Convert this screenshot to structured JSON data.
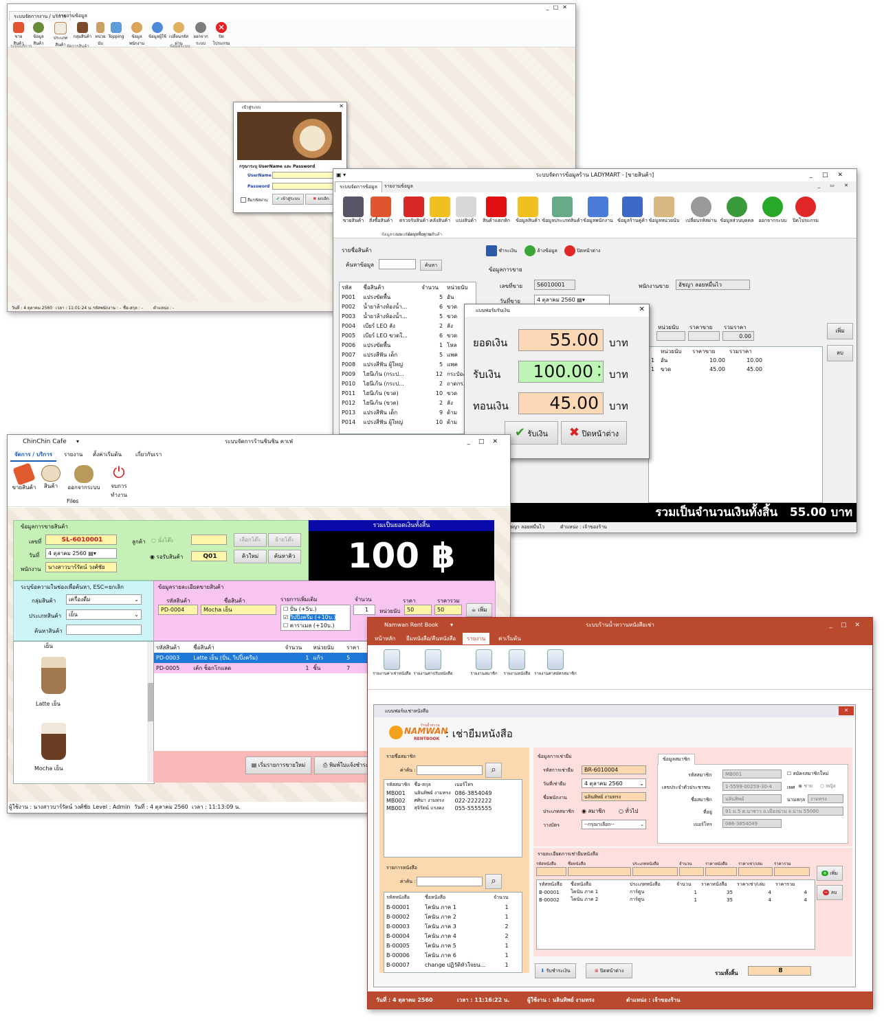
{
  "w1": {
    "tabs": [
      "ระบบจัดการงาน / บริการ",
      "รายงานข้อมูล"
    ],
    "tools": [
      "ขายสินค้า",
      "ข้อมูลสินค้า",
      "ประเภทสินค้า",
      "กลุ่มสินค้า",
      "หน่วยนับ",
      "Topping",
      "ข้อมูลพนักงาน",
      "ข้อมูลผู้ใช้",
      "เปลี่ยนรหัสผ่าน",
      "ออกจากระบบ",
      "ปิดโปรแกรม"
    ],
    "groups": [
      "ระบบบริการ",
      "จัดการสินค้า",
      "ข้อมูลระบบ"
    ],
    "status": [
      "วันที่ : 4 ตุลาคม 2560",
      "เวลา : 11:01:24 น.",
      "รหัสพนักงาน : -",
      "ชื่อ-สกุล : -",
      "ตำแหน่ง : -"
    ],
    "login": {
      "title": "เข้าสู่ระบบ",
      "prompt": "กรุณาระบุ UserName และ Password",
      "user_label": "UserName",
      "pass_label": "Password",
      "show_pass": "ลืมรหัสผ่าน",
      "login_btn": "เข้าสู่ระบบ",
      "cancel_btn": "ยกเลิก"
    }
  },
  "w2": {
    "title": "ระบบจัดการข้อมูลร้าน LADYMART - [ขายสินค้า]",
    "tabs": [
      "ระบบจัดการข้อมูล",
      "รายงานข้อมูล"
    ],
    "tools": [
      "ขายสินค้า",
      "สั่งซื้อสินค้า",
      "ตรวจรับสินค้า",
      "คลังสินค้า",
      "แบ่งสินค้า",
      "สินค้าแตกหัก",
      "ข้อมูลสินค้า",
      "ข้อมูลประเภทสินค้า",
      "ข้อมูลพนักงาน",
      "ข้อมูลร้านคู่ค้า",
      "ข้อมูลหน่วยนับ",
      "เปลี่ยนรหัสผ่าน",
      "ข้อมูลส่วนบุคคล",
      "ออกจากระบบ",
      "ปิดโปรแกรม"
    ],
    "groups": [
      "ระบบจัดการการขายสินค้า",
      "ข้อมูลพื้นฐาน",
      "ข้อมูลระบบ"
    ],
    "list_title": "รายชื่อสินค้า",
    "search_label": "ค้นหาข้อมูล",
    "search_btn": "ค้นหา",
    "cols": [
      "รหัส",
      "ชื่อสินค้า",
      "จำนวน",
      "หน่วยนับ"
    ],
    "rows": [
      [
        "P001",
        "แปรงขัดพื้น",
        "5",
        "อัน"
      ],
      [
        "P002",
        "น้ำยาล้างห้องน้ำ...",
        "6",
        "ขวด"
      ],
      [
        "P003",
        "น้ำยาล้างห้องน้ำ...",
        "5",
        "ขวด"
      ],
      [
        "P004",
        "เบียร์ LEO ลัง",
        "2",
        "ลัง"
      ],
      [
        "P005",
        "เบียร์ LEO ขวดใ...",
        "6",
        "ขวด"
      ],
      [
        "P006",
        "แปรงขัดพื้น",
        "1",
        "โหล"
      ],
      [
        "P007",
        "แปรงสีฟัน เด็ก",
        "5",
        "แพค"
      ],
      [
        "P008",
        "แปรงสีฟัน ผู้ใหญ่",
        "5",
        "แพค"
      ],
      [
        "P009",
        "ไฮนีเก้น (กระป...",
        "12",
        "กระป๋อง"
      ],
      [
        "P010",
        "ไฮนีเก้น (กระป...",
        "2",
        "ถาดกร..."
      ],
      [
        "P011",
        "ไฮนีเก้น (ขวด)",
        "10",
        "ขวด"
      ],
      [
        "P012",
        "ไฮนีเก้น (ขวด)",
        "2",
        "ลัง"
      ],
      [
        "P013",
        "แปรงสีฟัน เด็ก",
        "9",
        "ด้าม"
      ],
      [
        "P014",
        "แปรงสีฟัน ผู้ใหญ่",
        "10",
        "ด้าม"
      ]
    ],
    "save_btn": "ชำระเงิน",
    "clear_btn": "ล้างข้อมูล",
    "close_btn": "ปิดหน้าต่าง",
    "sale_title": "ข้อมูลการขาย",
    "billno_label": "เลขที่ขาย",
    "billno": "S6010001",
    "emp_label": "พนักงานขาย",
    "emp": "อัชญา ลอยหมื่นไว",
    "date_label": "วันที่ขาย",
    "date": "4   ตุลาคม     2560",
    "detail_cols": [
      "หน่วยนับ",
      "ราคาขาย",
      "รวมราคา"
    ],
    "detail_total": "0.00",
    "sale_cols": [
      "หน่วยนับ",
      "ราคาขาย",
      "รวมราคา"
    ],
    "sale_rows": [
      [
        "อัน",
        "10.00",
        "10.00"
      ],
      [
        "ขวด",
        "45.00",
        "45.00"
      ]
    ],
    "sale_qty": [
      "1",
      "1"
    ],
    "add_btn": "เพิ่ม",
    "del_btn": "ลบ",
    "total_text": "รวมเป็นจำนวนเงินทั้งสิ้น",
    "total_value": "55.00",
    "total_unit": "บาท",
    "status": [
      "อัชญา ลอยหมื่นไว",
      "ตำแหน่ง : เจ้าของร้าน"
    ],
    "pay": {
      "title": "แบบฟอร์มรับเงิน",
      "total_label": "ยอดเงิน",
      "total": "55.00",
      "recv_label": "รับเงิน",
      "recv": "100.00",
      "change_label": "ทอนเงิน",
      "change": "45.00",
      "unit": "บาท",
      "ok_btn": "รับเงิน",
      "close_btn": "ปิดหน้าต่าง"
    }
  },
  "w3": {
    "app": "ChinChin Cafe",
    "title": "ระบบจัดการร้านชินชิน คาเฟ่",
    "tabs": [
      "จัดการ / บริการ",
      "รายงาน",
      "ตั้งค่าเริ่มต้น",
      "เกี่ยวกับเรา"
    ],
    "tools": [
      "ขายสินค้า",
      "สินค้า",
      "ออกจากระบบ",
      "จบการทำงาน"
    ],
    "files": "Files",
    "sale_title": "ข้อมูลการขายสินค้า",
    "billno_label": "เลขที่",
    "billno": "SL-6010001",
    "date_label": "วันที่",
    "date": "4   ตุลาคม     2560",
    "emp_label": "พนักงาน",
    "emp": "นางสาวบาร์รัตน์ วงศ์ชัย",
    "cust_label": "ลูกค้า",
    "opt_table": "นั่งโต๊ะ",
    "opt_takeaway": "รอรับสินค้า",
    "queue": "Q01",
    "btn_choose_table": "เลือกโต๊ะ",
    "btn_move_table": "ย้ายโต๊ะ",
    "btn_new_queue": "คิวใหม่",
    "btn_search_queue": "ค้นหาคิว",
    "total_title": "รวมเป็นยอดเงินทั้งสิ้น",
    "total": "100 ฿",
    "filter_title": "ระบุข้อความในช่องเพื่อค้นหา, ESC=ยกเลิก",
    "group_label": "กลุ่มสินค้า",
    "group": "เครื่องดื่ม",
    "type_label": "ประเภทสินค้า",
    "type": "เย็น",
    "name_label": "ค้นหาสินค้า",
    "gallery_label": "เย็น",
    "products": [
      "Latte เย็น",
      "Mocha เย็น"
    ],
    "detail_title": "ข้อมูลรายละเอียดขายสินค้า",
    "fields": [
      "รหัสสินค้า",
      "ชื่อสินค้า",
      "รายการเพิ่มเติม",
      "จำนวน",
      "ราคา",
      "ราคารวม"
    ],
    "code": "PD-0004",
    "name": "Mocha เย็น",
    "extras": [
      "ปั่น (+5บ.)",
      "วิปปิ้งครีม (+10บ.)",
      "คาราเมล (+10บ.)"
    ],
    "qty": "1",
    "unit": "หน่วยนับ",
    "price": "50",
    "sum": "50",
    "add_btn": "เพิ่ม",
    "cols": [
      "รหัสสินค้า",
      "ชื่อสินค้า",
      "จำนวน",
      "หน่วยนับ",
      "ราคา"
    ],
    "rows": [
      [
        "PD-0003",
        "Latte เย็น (ปั่น, วิปปิ้งครีม)",
        "1",
        "แก้ว",
        "5"
      ],
      [
        "PD-0005",
        "เค้ก ช็อกโกแลต",
        "1",
        "ชิ้น",
        "7"
      ]
    ],
    "btn_new": "เริ่มรายการขายใหม่",
    "btn_print": "พิมพ์ใบแจ้งชำระ",
    "status": [
      "ผู้ใช้งาน : นางสาวบาร์รัตน์ วงศ์ชัย",
      "Level : Admin",
      "วันที่ : 4 ตุลาคม 2560",
      "เวลา : 11:13:09 น."
    ]
  },
  "w4": {
    "app": "Namwan Rent Book",
    "title": "ระบบร้านน้ำหวานหนังสือเช่า",
    "tabs": [
      "หน้าหลัก",
      "ยืมหนังสือ/คืนหนังสือ",
      "รายงาน",
      "ค่าเริ่มต้น"
    ],
    "tools": [
      "รายงานค่าเช่าหนังสือ",
      "รายงานค่าปรับหนังสือ",
      "รายงานสมาชิก",
      "รายงานหนังสือ",
      "รายงานค่าสมัครสมาชิก"
    ],
    "form_title": "แบบฟอร์มเช่าหนังสือ",
    "logo_top": "NAMWAN",
    "logo_bottom": "RENTBOOK",
    "logo_small": "ร้านน้ำหวาน",
    "heading": ": เช่ายืมหนังสือ",
    "member_list": "รายชื่อสมาชิก",
    "search_label": "ค่าค้น :",
    "member_cols": [
      "รหัสสมาชิก",
      "ชื่อ-สกุล",
      "เบอร์โทร"
    ],
    "members": [
      [
        "MB001",
        "นลินทิพย์ งามทรง",
        "086-3854049"
      ],
      [
        "MB002",
        "ศศิมา งามทรง",
        "022-2222222"
      ],
      [
        "MB003",
        "สุจิรัตน์ แรงคง",
        "055-5555555"
      ]
    ],
    "book_list": "รายการหนังสือ",
    "book_cols": [
      "รหัสหนังสือ",
      "ชื่อหนังสือ",
      "จำนวน"
    ],
    "books": [
      [
        "B-00001",
        "โคนัน ภาค 1",
        "1"
      ],
      [
        "B-00002",
        "โคนัน ภาค 2",
        "1"
      ],
      [
        "B-00003",
        "โคนัน ภาค 3",
        "2"
      ],
      [
        "B-00004",
        "โคนัน ภาค 4",
        "2"
      ],
      [
        "B-00005",
        "โคนัน ภาค 5",
        "1"
      ],
      [
        "B-00006",
        "โคนัน ภาค 6",
        "1"
      ],
      [
        "B-00007",
        "change ปฏิวัติหัวใจยน...",
        "1"
      ]
    ],
    "rent_title": "ข้อมูลการเช่ายืม",
    "rent_no_label": "รหัสการเช่ายืม",
    "rent_no": "BR-6010004",
    "date_label": "วันที่เช่ายืม",
    "date": "4   ตุลาคม     2560",
    "staff_label": "ชื่อพนักงาน",
    "staff": "นลินทิพย์ งามทรง",
    "mtype_label": "ประเภทสมาชิก",
    "mtype_a": "สมาชิก",
    "mtype_b": "ทั่วไป",
    "card_label": "วางบัตร",
    "card": "--กรุณาเลือก--",
    "member_tab": "ข้อมูลสมาชิก",
    "m_id_label": "รหัสสมาชิก",
    "m_id": "MB001",
    "m_new": "สมัครสมาชิกใหม่",
    "m_cid_label": "เลขประจำตัวประชาชน",
    "m_cid": "1-5599-00259-30-4",
    "m_sex_label": "เพศ",
    "m_sex_a": "ชาย",
    "m_sex_b": "หญิง",
    "m_name_label": "ชื่อสมาชิก",
    "m_name": "นลินทิพย์",
    "m_sur_label": "นามสกุล",
    "m_sur": "งามทรง",
    "m_addr_label": "ที่อยู่",
    "m_addr": "91 ม.5 ต.นาซาว อ.เมืองน่าน จ.น่าน 55000",
    "m_tel_label": "เบอร์โทร",
    "m_tel": "086-3854049",
    "detail_title": "รายละเอียดการเช่ายืมหนังสือ",
    "detail_cols": [
      "รหัสหนังสือ",
      "ชื่อหนังสือ",
      "ประเภทหนังสือ",
      "จำนวน",
      "ราคาหนังสือ",
      "ราคาเช่า/เล่ม",
      "ราคารวม"
    ],
    "detail_rows": [
      [
        "B-00001",
        "โคนัน ภาค 1",
        "การ์ตูน",
        "1",
        "35",
        "4",
        "4"
      ],
      [
        "B-00002",
        "โคนัน ภาค 2",
        "การ์ตูน",
        "1",
        "35",
        "4",
        "4"
      ]
    ],
    "add_btn": "เพิ่ม",
    "del_btn": "ลบ",
    "pay_btn": "รับชำระเงิน",
    "close_btn": "ปิดหน้าต่าง",
    "total_label": "รวมทั้งสิ้น",
    "total": "8",
    "status": [
      "วันที่ :  4 ตุลาคม 2560",
      "เวลา :    11:16:22 น.",
      "ผู้ใช้งาน :  นลินทิพย์ งามทรง",
      "ตำแหน่ง :  เจ้าของร้าน"
    ]
  },
  "colors": {
    "namwan_bar": "#b94a2e",
    "ladymart_total_bg": "#000000",
    "cafe_total_bg": "#000000",
    "highlight_peach": "#fcd9b6",
    "highlight_green": "#bdf5b5"
  }
}
